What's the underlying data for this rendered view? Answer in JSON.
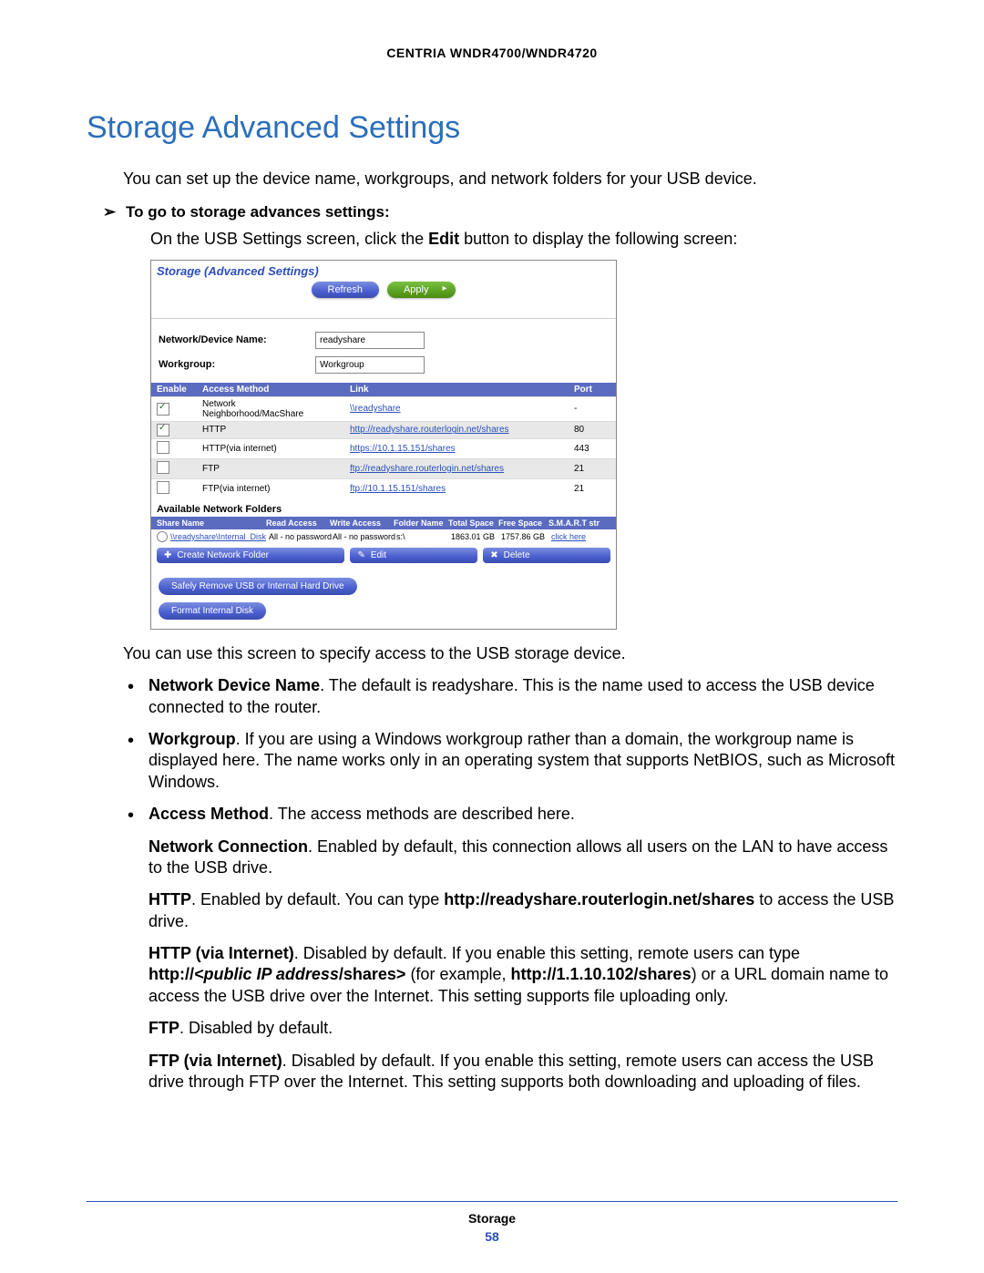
{
  "header": {
    "model": "CENTRIA WNDR4700/WNDR4720"
  },
  "title": "Storage Advanced Settings",
  "intro": "You can set up the device name, workgroups, and network folders for your USB device.",
  "arrow_line": "To go to storage advances settings:",
  "step_pre": "On the USB Settings screen, click the ",
  "step_bold": "Edit",
  "step_post": " button to display the following screen:",
  "screenshot": {
    "title": "Storage (Advanced Settings)",
    "refresh": "Refresh",
    "apply": "Apply",
    "device_label": "Network/Device Name:",
    "device_value": "readyshare",
    "workgroup_label": "Workgroup:",
    "workgroup_value": "Workgroup",
    "th_enable": "Enable",
    "th_method": "Access Method",
    "th_link": "Link",
    "th_port": "Port",
    "rows": [
      {
        "checked": true,
        "method": "Network Neighborhood/MacShare",
        "link": "\\\\readyshare",
        "port": "-"
      },
      {
        "checked": true,
        "method": "HTTP",
        "link": "http://readyshare.routerlogin.net/shares",
        "port": "80"
      },
      {
        "checked": false,
        "method": "HTTP(via internet)",
        "link": "https://10.1.15.151/shares",
        "port": "443"
      },
      {
        "checked": false,
        "method": "FTP",
        "link": "ftp://readyshare.routerlogin.net/shares",
        "port": "21"
      },
      {
        "checked": false,
        "method": "FTP(via internet)",
        "link": "ftp://10.1.15.151/shares",
        "port": "21"
      }
    ],
    "folders_title": "Available Network Folders",
    "fh_share": "Share Name",
    "fh_read": "Read Access",
    "fh_write": "Write Access",
    "fh_folder": "Folder Name",
    "fh_total": "Total Space",
    "fh_free": "Free Space",
    "fh_smart": "S.M.A.R.T str",
    "folder_row": {
      "share": "\\\\readyshare\\Internal_Disk",
      "read": "All - no password",
      "write": "All - no password",
      "folder": "s:\\",
      "total": "1863.01 GB",
      "free": "1757.86 GB",
      "smart": "click here"
    },
    "create": "Create Network Folder",
    "edit": "Edit",
    "delete": "Delete",
    "safely_remove": "Safely Remove USB or Internal Hard Drive",
    "format": "Format Internal Disk"
  },
  "after_ss": "You can use this screen to specify access to the USB storage device.",
  "bullets": {
    "b1_b": "Network Device Name",
    "b1_t": ". The default is readyshare. This is the name used to access the USB device connected to the router.",
    "b2_b": "Workgroup",
    "b2_t": ". If you are using a Windows workgroup rather than a domain, the workgroup name is displayed here. The name works only in an operating system that supports NetBIOS, such as Microsoft Windows.",
    "b3_b": "Access Method",
    "b3_t": ". The access methods are described here."
  },
  "sub": {
    "nc_b": "Network Connection",
    "nc_t": ". Enabled by default, this connection allows all users on the LAN to have access to the USB drive.",
    "http_b": "HTTP",
    "http_t1": ". Enabled by default. You can type ",
    "http_url": "http://readyshare.routerlogin.net/shares",
    "http_t2": " to access the USB drive.",
    "httpi_b": "HTTP (via Internet)",
    "httpi_t1": ". Disabled by default. If you enable this setting, remote users can type ",
    "httpi_b2": "http://<public IP address/shares>",
    "httpi_t2": " (for example, ",
    "httpi_b3": "http://1.1.10.102/shares",
    "httpi_t3": ") or a URL domain name to access the USB drive over the Internet. This setting supports file uploading only.",
    "ftp_b": "FTP",
    "ftp_t": ". Disabled by default.",
    "ftpi_b": "FTP (via Internet)",
    "ftpi_t": ". Disabled by default. If you enable this setting, remote users can access the USB drive through FTP over the Internet. This setting supports both downloading and uploading of files."
  },
  "footer": {
    "section": "Storage",
    "page": "58"
  }
}
